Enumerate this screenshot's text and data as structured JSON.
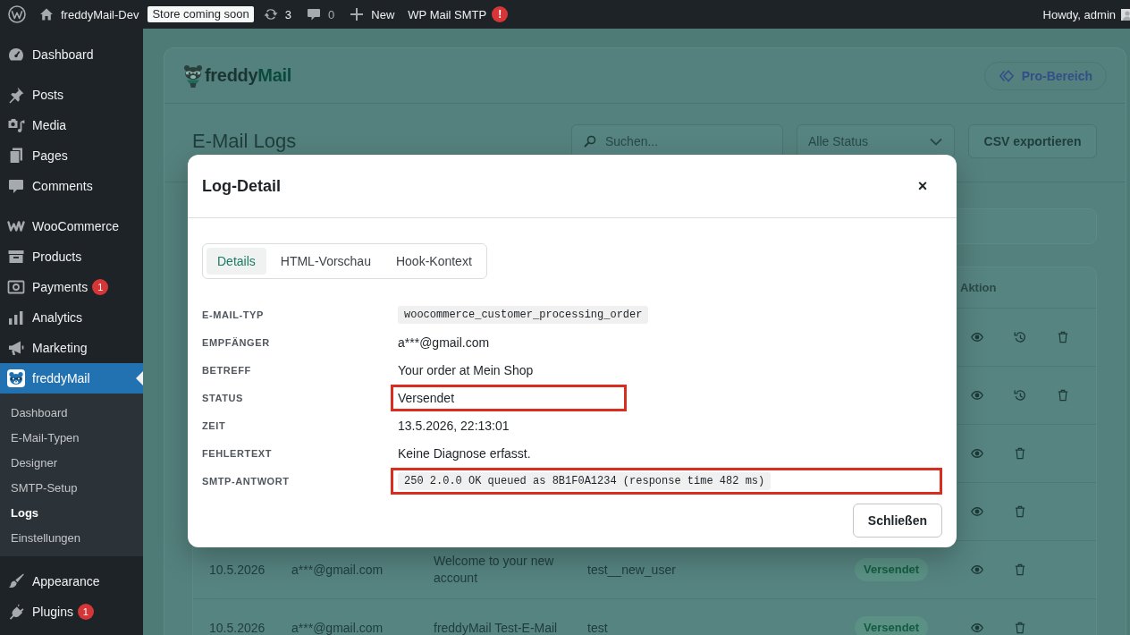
{
  "admin_bar": {
    "site_name": "freddyMail-Dev",
    "store_badge": "Store coming soon",
    "updates_count": "3",
    "comments_count": "0",
    "new_label": "New",
    "smtp_label": "WP Mail SMTP",
    "smtp_notice": "!",
    "greeting": "Howdy, admin"
  },
  "sidebar": {
    "sections": [
      {
        "items": [
          {
            "label": "Dashboard",
            "selected": false
          }
        ]
      },
      {
        "items": [
          {
            "label": "Posts",
            "selected": false
          },
          {
            "label": "Media",
            "selected": false
          },
          {
            "label": "Pages",
            "selected": false
          },
          {
            "label": "Comments",
            "selected": false
          }
        ]
      },
      {
        "items": [
          {
            "label": "WooCommerce",
            "selected": false
          },
          {
            "label": "Products",
            "selected": false
          },
          {
            "label": "Payments",
            "selected": false,
            "badge": "1"
          },
          {
            "label": "Analytics",
            "selected": false
          },
          {
            "label": "Marketing",
            "selected": false
          },
          {
            "label": "freddyMail",
            "selected": true,
            "children": [
              {
                "label": "Dashboard",
                "selected": false
              },
              {
                "label": "E-Mail-Typen",
                "selected": false
              },
              {
                "label": "Designer",
                "selected": false
              },
              {
                "label": "SMTP-Setup",
                "selected": false
              },
              {
                "label": "Logs",
                "selected": true
              },
              {
                "label": "Einstellungen",
                "selected": false
              }
            ]
          }
        ]
      },
      {
        "items": [
          {
            "label": "Appearance",
            "selected": false
          },
          {
            "label": "Plugins",
            "selected": false,
            "badge": "1"
          }
        ]
      }
    ]
  },
  "plugin_header": {
    "logo": {
      "wordmark_dark": "freddy",
      "wordmark_accent": "Mail"
    },
    "pro_button": "Pro-Bereich"
  },
  "toolbar": {
    "title": "E-Mail Logs",
    "search": {
      "placeholder": "Suchen..."
    },
    "status_filter": {
      "value": "Alle Status"
    },
    "export_button": "CSV exportieren"
  },
  "table": {
    "action_header": "Aktion",
    "rows": [
      {
        "resend": true
      },
      {
        "resend": true
      },
      {
        "resend": false
      },
      {
        "resend": false
      },
      {
        "date": "10.5.2026",
        "recipient": "a***@gmail.com",
        "subject": "Welcome to your new account",
        "type": "test__new_user",
        "status": "Versendet",
        "resend": false
      },
      {
        "date": "10.5.2026",
        "recipient": "a***@gmail.com",
        "subject": "freddyMail Test-E-Mail",
        "type": "test",
        "status": "Versendet",
        "resend": false
      }
    ]
  },
  "modal": {
    "title": "Log-Detail",
    "close": "×",
    "tabs": [
      {
        "label": "Details",
        "selected": true
      },
      {
        "label": "HTML-Vorschau",
        "selected": false
      },
      {
        "label": "Hook-Kontext",
        "selected": false
      }
    ],
    "fields": [
      {
        "label": "E-MAIL-TYP",
        "value": "woocommerce_customer_processing_order",
        "kind": "code",
        "highlighted": false
      },
      {
        "label": "EMPFÄNGER",
        "value": "a***@gmail.com",
        "kind": "text",
        "highlighted": false
      },
      {
        "label": "BETREFF",
        "value": "Your order at Mein Shop",
        "kind": "text",
        "highlighted": false
      },
      {
        "label": "STATUS",
        "value": "Versendet",
        "kind": "text",
        "highlighted": true
      },
      {
        "label": "ZEIT",
        "value": "13.5.2026, 22:13:01",
        "kind": "text",
        "highlighted": false
      },
      {
        "label": "FEHLERTEXT",
        "value": "Keine Diagnose erfasst.",
        "kind": "text",
        "highlighted": false
      },
      {
        "label": "SMTP-ANTWORT",
        "value": "250 2.0.0 OK queued as 8B1F0A1234 (response time 482 ms)",
        "kind": "code",
        "highlighted": true
      }
    ],
    "close_button": "Schließen"
  }
}
